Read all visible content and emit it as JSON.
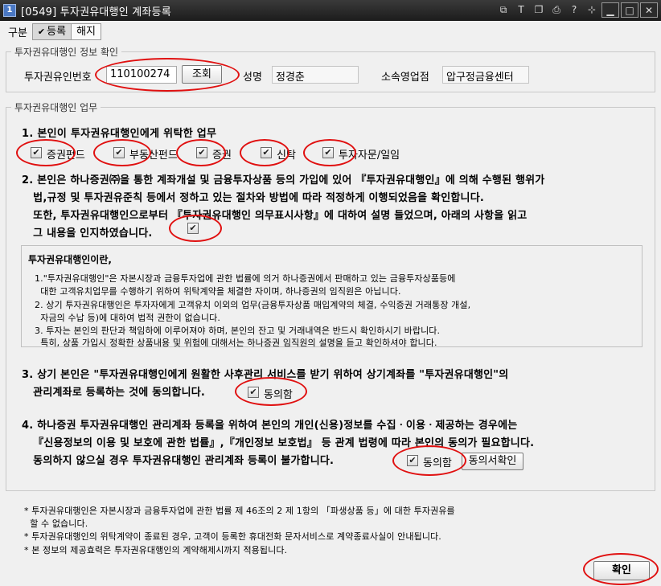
{
  "window": {
    "app_icon": "1",
    "title": "[0549] 투자권유대행인 계좌등록",
    "tool_icons": [
      "window-icon",
      "text-icon",
      "copy-icon",
      "print-icon",
      "help-icon",
      "pin-icon",
      "minimize-icon",
      "maximize-icon",
      "close-icon"
    ],
    "tool_glyphs": [
      "⧉",
      "T",
      "❐",
      "⎙",
      "?",
      "⊹",
      "▁",
      "□",
      "✕"
    ]
  },
  "topbar": {
    "label": "구분",
    "options": [
      "등록",
      "해지"
    ],
    "selected": "등록"
  },
  "info_group": {
    "title": "투자권유대행인 정보 확인",
    "id_label": "투자권유인번호",
    "id_value": "110100274",
    "search_button": "조회",
    "name_label": "성명",
    "name_value": "정경춘",
    "branch_label": "소속영업점",
    "branch_value": "압구정금융센터"
  },
  "duty_group": {
    "title": "투자권유대행인 업무",
    "section1": {
      "heading": "1. 본인이 투자권유대행인에게 위탁한 업무",
      "items": [
        "증권펀드",
        "부동산펀드",
        "증권",
        "신탁",
        "투자자문/일임"
      ]
    },
    "section2": {
      "lines": [
        "2. 본인은 하나증권㈜을 통한 계좌개설 및 금융투자상품 등의 가입에 있어 『투자권유대행인』에 의해 수행된 행위가",
        "   법,규정 및 투자권유준칙 등에서 정하고 있는 절차와 방법에 따라 적정하게 이행되었음을 확인합니다.",
        "   또한, 투자권유대행인으로부터 『투자권유대행인 의무표시사항』에 대하여 설명 들었으며, 아래의 사항을 읽고",
        "   그 내용을 인지하였습니다."
      ]
    },
    "infobox": {
      "title": "투자권유대행인이란,",
      "lines": [
        "1.\"투자권유대행인\"은 자본시장과 금융투자업에 관한 법률에 의거 하나증권에서 판매하고 있는 금융투자상품등에",
        "  대한 고객유치업무를 수행하기 위하여 위탁계약을 체결한 자이며, 하나증권의 임직원은 아닙니다.",
        "2. 상기 투자권유대행인은 투자자에게 고객유치 이외의 업무(금융투자상품 매입계약의 체결, 수익증권 거래통장 개설,",
        "  자금의 수납 등)에 대하여 법적 권한이 없습니다.",
        "3. 투자는 본인의 판단과 책임하에 이루어져야 하며, 본인의 잔고 및 거래내역은 반드시 확인하시기 바랍니다.",
        "  특히, 상품 가입시 정확한 상품내용 및 위험에 대해서는 하나증권 임직원의 설명을 듣고 확인하셔야 합니다."
      ]
    },
    "section3": {
      "lines": [
        "3. 상기 본인은 \"투자권유대행인에게 원활한 사후관리 서비스를 받기 위하여 상기계좌를 \"투자권유대행인\"의",
        "   관리계좌로 등록하는 것에 동의합니다."
      ],
      "agree_label": "동의함"
    },
    "section4": {
      "lines": [
        "4. 하나증권 투자권유대행인 관리계좌 등록을 위하여 본인의 개인(신용)정보를 수집ㆍ이용ㆍ제공하는 경우에는",
        "   『신용정보의 이용 및 보호에 관한 법률』,『개인정보 보호법』 등 관계 법령에 따라 본인의 동의가 필요합니다.",
        "   동의하지 않으실 경우 투자권유대행인 관리계좌 등록이 불가합니다."
      ],
      "agree_label": "동의함",
      "consent_button": "동의서확인"
    }
  },
  "notes": [
    "* 투자권유대행인은 자본시장과 금융투자업에 관한 법률 제 46조의 2 제 1항의 「파생상품 등」에 대한 투자권유를",
    "  할 수 없습니다.",
    "* 투자권유대행인의 위탁계약이 종료된 경우, 고객이 등록한 휴대전화 문자서비스로 계약종료사실이 안내됩니다.",
    "* 본 정보의 제공효력은 투자권유대행인의 계약해제시까지 적용됩니다."
  ],
  "confirm_button": "확인",
  "colors": {
    "annotation": "#e01010",
    "titlebar": "#262626",
    "background": "#f0f0f0"
  }
}
